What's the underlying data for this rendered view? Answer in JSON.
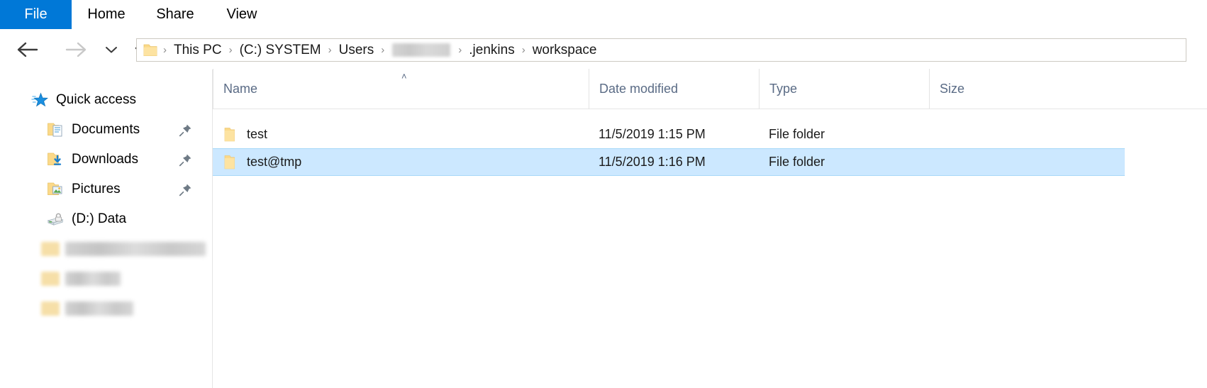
{
  "window": {
    "app": "File Explorer"
  },
  "ribbon": {
    "tabs": [
      {
        "label": "File",
        "name": "tab-file",
        "active": true
      },
      {
        "label": "Home",
        "name": "tab-home",
        "active": false
      },
      {
        "label": "Share",
        "name": "tab-share",
        "active": false
      },
      {
        "label": "View",
        "name": "tab-view",
        "active": false
      }
    ]
  },
  "navigation": {
    "back_icon": "arrow-left-icon",
    "forward_icon": "arrow-right-icon",
    "recent_icon": "chevron-down-icon",
    "up_icon": "arrow-up-icon",
    "back_enabled": true,
    "forward_enabled": false
  },
  "address_bar": {
    "folder_icon": "folder-icon",
    "separator": "›",
    "crumbs": [
      {
        "label": "This PC",
        "redacted": false
      },
      {
        "label": "(C:) SYSTEM",
        "redacted": false
      },
      {
        "label": "Users",
        "redacted": false
      },
      {
        "label": "",
        "redacted": true
      },
      {
        "label": ".jenkins",
        "redacted": false
      },
      {
        "label": "workspace",
        "redacted": false
      }
    ]
  },
  "sidebar": {
    "items": [
      {
        "label": "Quick access",
        "icon": "quick-access-star-icon",
        "pinned": false,
        "redacted": false
      },
      {
        "label": "Documents",
        "icon": "documents-folder-icon",
        "pinned": true,
        "redacted": false
      },
      {
        "label": "Downloads",
        "icon": "downloads-folder-icon",
        "pinned": true,
        "redacted": false
      },
      {
        "label": "Pictures",
        "icon": "pictures-folder-icon",
        "pinned": true,
        "redacted": false
      },
      {
        "label": "(D:) Data",
        "icon": "locked-drive-icon",
        "pinned": false,
        "redacted": false
      },
      {
        "label": "",
        "icon": "folder-icon",
        "pinned": false,
        "redacted": true
      },
      {
        "label": "",
        "icon": "folder-icon",
        "pinned": false,
        "redacted": true
      },
      {
        "label": "",
        "icon": "folder-icon",
        "pinned": false,
        "redacted": true
      }
    ],
    "pin_icon": "pin-icon"
  },
  "file_list": {
    "columns": [
      {
        "label": "Name",
        "sorted": true,
        "sort_direction": "ascending"
      },
      {
        "label": "Date modified",
        "sorted": false,
        "sort_direction": ""
      },
      {
        "label": "Type",
        "sorted": false,
        "sort_direction": ""
      },
      {
        "label": "Size",
        "sorted": false,
        "sort_direction": ""
      }
    ],
    "sort_indicator": "˄",
    "rows": [
      {
        "name": "test",
        "date_modified": "11/5/2019 1:15 PM",
        "type": "File folder",
        "size": "",
        "icon": "folder-icon",
        "selected": false
      },
      {
        "name": "test@tmp",
        "date_modified": "11/5/2019 1:16 PM",
        "type": "File folder",
        "size": "",
        "icon": "folder-icon",
        "selected": true
      }
    ]
  },
  "colors": {
    "accent": "#0078d7",
    "selection": "#cce8ff",
    "selection_border": "#a8d8f8",
    "header_text": "#5a6b85",
    "folder_yellow": "#ffd77a"
  }
}
